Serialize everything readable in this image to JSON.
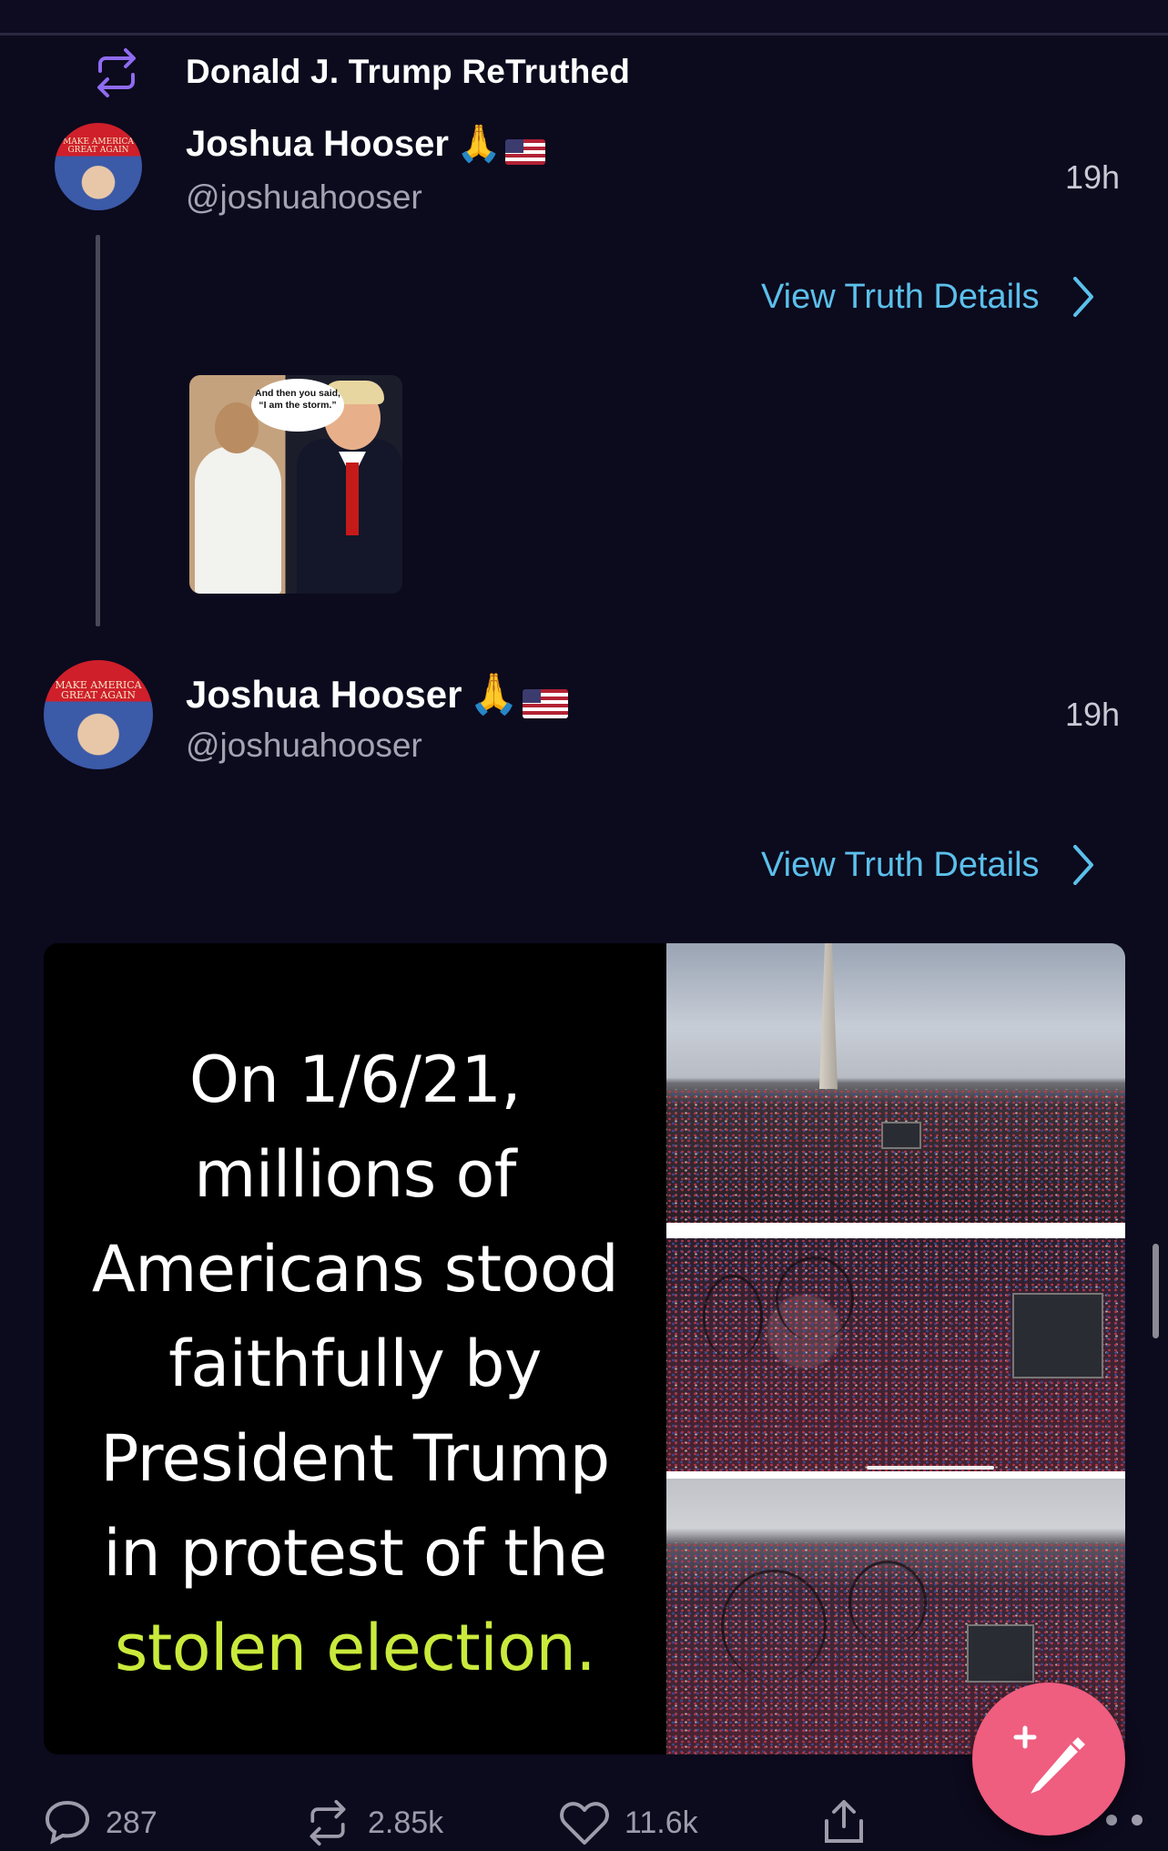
{
  "retruth": {
    "text": "Donald J. Trump ReTruthed"
  },
  "post1": {
    "name": "Joshua Hooser",
    "handle": "@joshuahooser",
    "time": "19h",
    "view_details": "View Truth Details",
    "media_caption": "And then you said, “I am the storm.”",
    "avatar_cap": "MAKE AMERICA GREAT AGAIN"
  },
  "post2": {
    "name": "Joshua Hooser",
    "handle": "@joshuahooser",
    "time": "19h",
    "view_details": "View Truth Details",
    "avatar_cap": "MAKE AMERICA GREAT AGAIN",
    "image_text": {
      "line1": "On 1/6/21,",
      "line2": "millions of",
      "line3": "Americans stood",
      "line4": "faithfully by",
      "line5": "President Trump",
      "line6": "in protest of the",
      "accent": "stolen election."
    }
  },
  "actions": {
    "replies": "287",
    "retruths": "2.85k",
    "likes": "11.6k"
  },
  "colors": {
    "background": "#0c0a1d",
    "link": "#5bc0eb",
    "accent_text": "#c9ea3c",
    "fab": "#ef5d7f",
    "repost_icon": "#8f6bf0"
  },
  "icons": [
    "retruth-icon",
    "chevron-right-icon",
    "reply-icon",
    "retruth-action-icon",
    "like-icon",
    "share-icon",
    "more-icon",
    "compose-icon"
  ]
}
